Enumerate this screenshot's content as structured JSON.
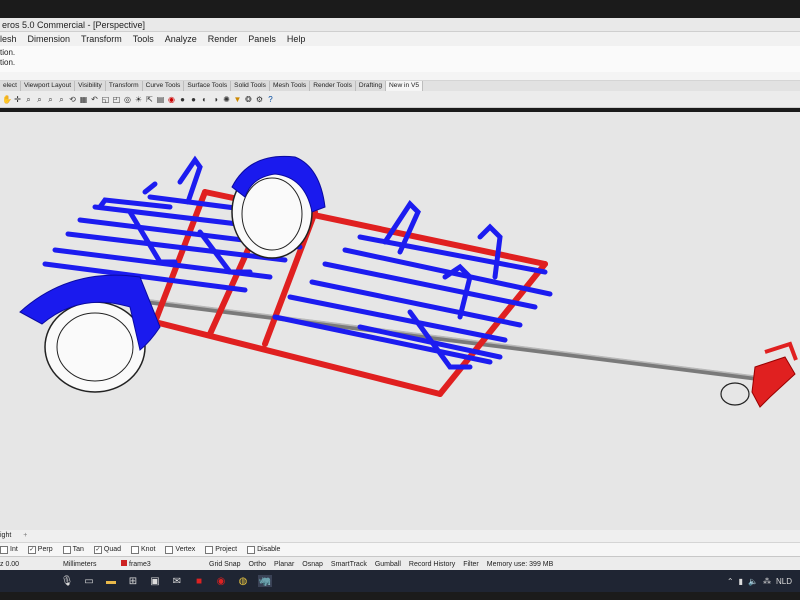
{
  "window": {
    "title": "eros 5.0 Commercial - [Perspective]"
  },
  "menu": [
    "lesh",
    "Dimension",
    "Transform",
    "Tools",
    "Analyze",
    "Render",
    "Panels",
    "Help"
  ],
  "command_history": [
    "tion.",
    "tion."
  ],
  "tabs": [
    "elect",
    "Viewport Layout",
    "Visibility",
    "Transform",
    "Curve Tools",
    "Surface Tools",
    "Solid Tools",
    "Mesh Tools",
    "Render Tools",
    "Drafting",
    "New in V5"
  ],
  "viewport_tabs": {
    "label": "ight"
  },
  "osnap": [
    {
      "label": "Int",
      "checked": false
    },
    {
      "label": "Perp",
      "checked": true
    },
    {
      "label": "Tan",
      "checked": false
    },
    {
      "label": "Quad",
      "checked": true
    },
    {
      "label": "Knot",
      "checked": false
    },
    {
      "label": "Vertex",
      "checked": false
    },
    {
      "label": "Project",
      "checked": false
    },
    {
      "label": "Disable",
      "checked": false
    }
  ],
  "status": {
    "coord": "z 0.00",
    "units": "Millimeters",
    "layer": "frame3",
    "grid_snap": "Grid Snap",
    "ortho": "Ortho",
    "planar": "Planar",
    "osnap": "Osnap",
    "smarttrack": "SmartTrack",
    "gumball": "Gumball",
    "record_history": "Record History",
    "filter": "Filter",
    "memory": "Memory use: 399 MB"
  },
  "tray": {
    "lang": "NLD"
  },
  "colors": {
    "frame_red": "#e02020",
    "rack_blue": "#1c1cf0",
    "axle_gray": "#7a7a7a",
    "viewport_bg": "#e6e6e6"
  }
}
